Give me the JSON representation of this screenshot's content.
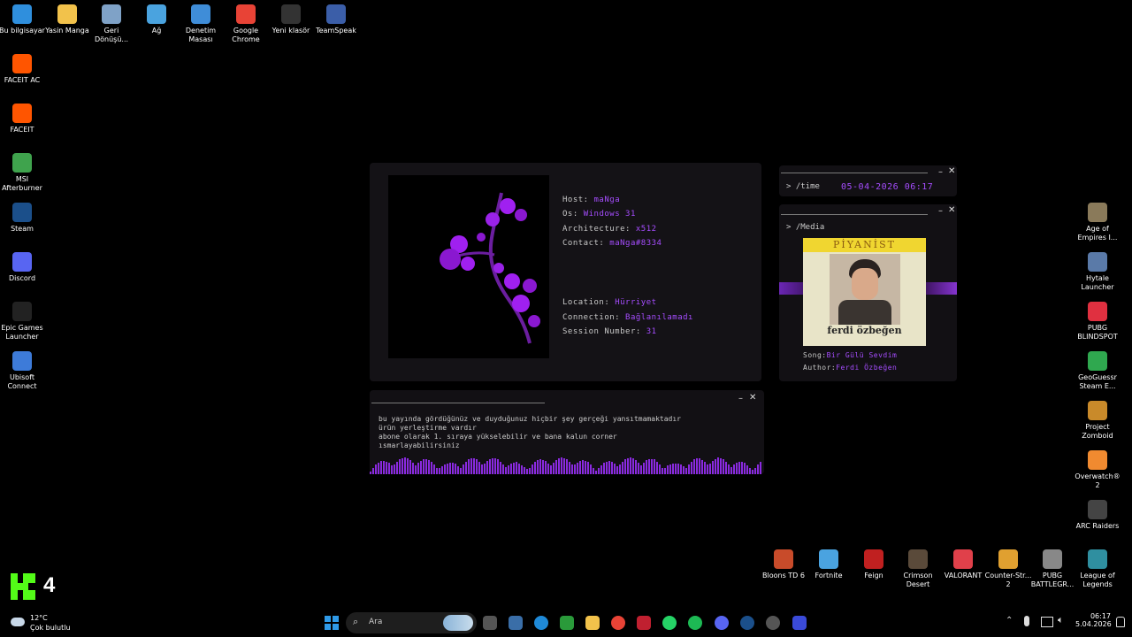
{
  "desktop_left_icons": [
    {
      "label": "Bu bilgisayar",
      "color": "#2f8fdd"
    },
    {
      "label": "Yasin Manga",
      "color": "#f2c24b"
    },
    {
      "label": "Geri\nDönüşü...",
      "color": "#7fa2c7"
    },
    {
      "label": "Ağ",
      "color": "#4aa3df"
    },
    {
      "label": "Denetim\nMasası",
      "color": "#3f8dd8"
    },
    {
      "label": "Google\nChrome",
      "color": "#e84336"
    },
    {
      "label": "Yeni klasör",
      "color": "#333333"
    },
    {
      "label": "TeamSpeak",
      "color": "#3b5ea8"
    }
  ],
  "desktop_column_icons": [
    {
      "label": "FACEIT AC",
      "color": "#ff5500"
    },
    {
      "label": "FACEIT",
      "color": "#ff5500"
    },
    {
      "label": "MSI\nAfterburner",
      "color": "#3fa34d"
    },
    {
      "label": "Steam",
      "color": "#1b4f8a"
    },
    {
      "label": "Discord",
      "color": "#5865f2"
    },
    {
      "label": "Epic Games\nLauncher",
      "color": "#222222"
    },
    {
      "label": "Ubisoft\nConnect",
      "color": "#3d7bd9"
    }
  ],
  "desktop_right_icons": [
    {
      "label": "Age of\nEmpires I...",
      "color": "#8a7a5a"
    },
    {
      "label": "Hytale\nLauncher",
      "color": "#5a7aa8"
    },
    {
      "label": "PUBG\nBLINDSPOT",
      "color": "#e03040"
    },
    {
      "label": "GeoGuessr\nSteam E...",
      "color": "#2fa84f"
    },
    {
      "label": "Project\nZomboid",
      "color": "#c98a2a"
    },
    {
      "label": "Overwatch®\n2",
      "color": "#f08a30"
    },
    {
      "label": "ARC Raiders",
      "color": "#444444"
    }
  ],
  "desktop_bottom_icons": [
    {
      "label": "Bloons TD 6",
      "color": "#c84b2a"
    },
    {
      "label": "Fortnite",
      "color": "#4aa3e0"
    },
    {
      "label": "Feign",
      "color": "#c02020"
    },
    {
      "label": "Crimson\nDesert",
      "color": "#5a4a3a"
    },
    {
      "label": "VALORANT",
      "color": "#e0404a"
    },
    {
      "label": "Counter-Str...\n2",
      "color": "#e0a030"
    },
    {
      "label": "PUBG\nBATTLEGR...",
      "color": "#888888"
    },
    {
      "label": "League of\nLegends",
      "color": "#2f8fa0"
    }
  ],
  "info": {
    "host_label": "Host: ",
    "host_value": "maNga",
    "os_label": "Os: ",
    "os_value": "Windows 31",
    "arch_label": "Architecture: ",
    "arch_value": "x512",
    "contact_label": "Contact: ",
    "contact_value": "maNga#8334",
    "location_label": "Location: ",
    "location_value": "Hürriyet",
    "connection_label": "Connection: ",
    "connection_value": "Bağlanılamadı",
    "session_label": "Session Number: ",
    "session_value": "31"
  },
  "time_widget": {
    "prompt": "> /time",
    "value": "05-04-2026 06:17"
  },
  "media_widget": {
    "prompt": "> /Media",
    "album_top": "PİYANİST",
    "album_bottom": "ferdi özbeğen",
    "song_label": "Song:",
    "song_value": "Bir Gülü Sevdim",
    "author_label": "Author:",
    "author_value": "Ferdi Özbeğen"
  },
  "marquee": {
    "lines": [
      "bu yayında gördüğünüz ve duyduğunuz hiçbir şey gerçeği yansıtmamaktadır",
      "ürün yerleştirme vardır",
      "abone olarak 1. sıraya yükselebilir ve bana kalun corner",
      "ısmarlayabilirsiniz"
    ]
  },
  "kick_widget": {
    "number": "4"
  },
  "weather": {
    "temp": "12°C",
    "desc": "Çok bulutlu"
  },
  "search": {
    "placeholder": "Ara"
  },
  "clock": {
    "time": "06:17",
    "date": "5.04.2026"
  },
  "colors": {
    "accent": "#a64dff",
    "panel": "#141216",
    "kick": "#53fc18"
  }
}
